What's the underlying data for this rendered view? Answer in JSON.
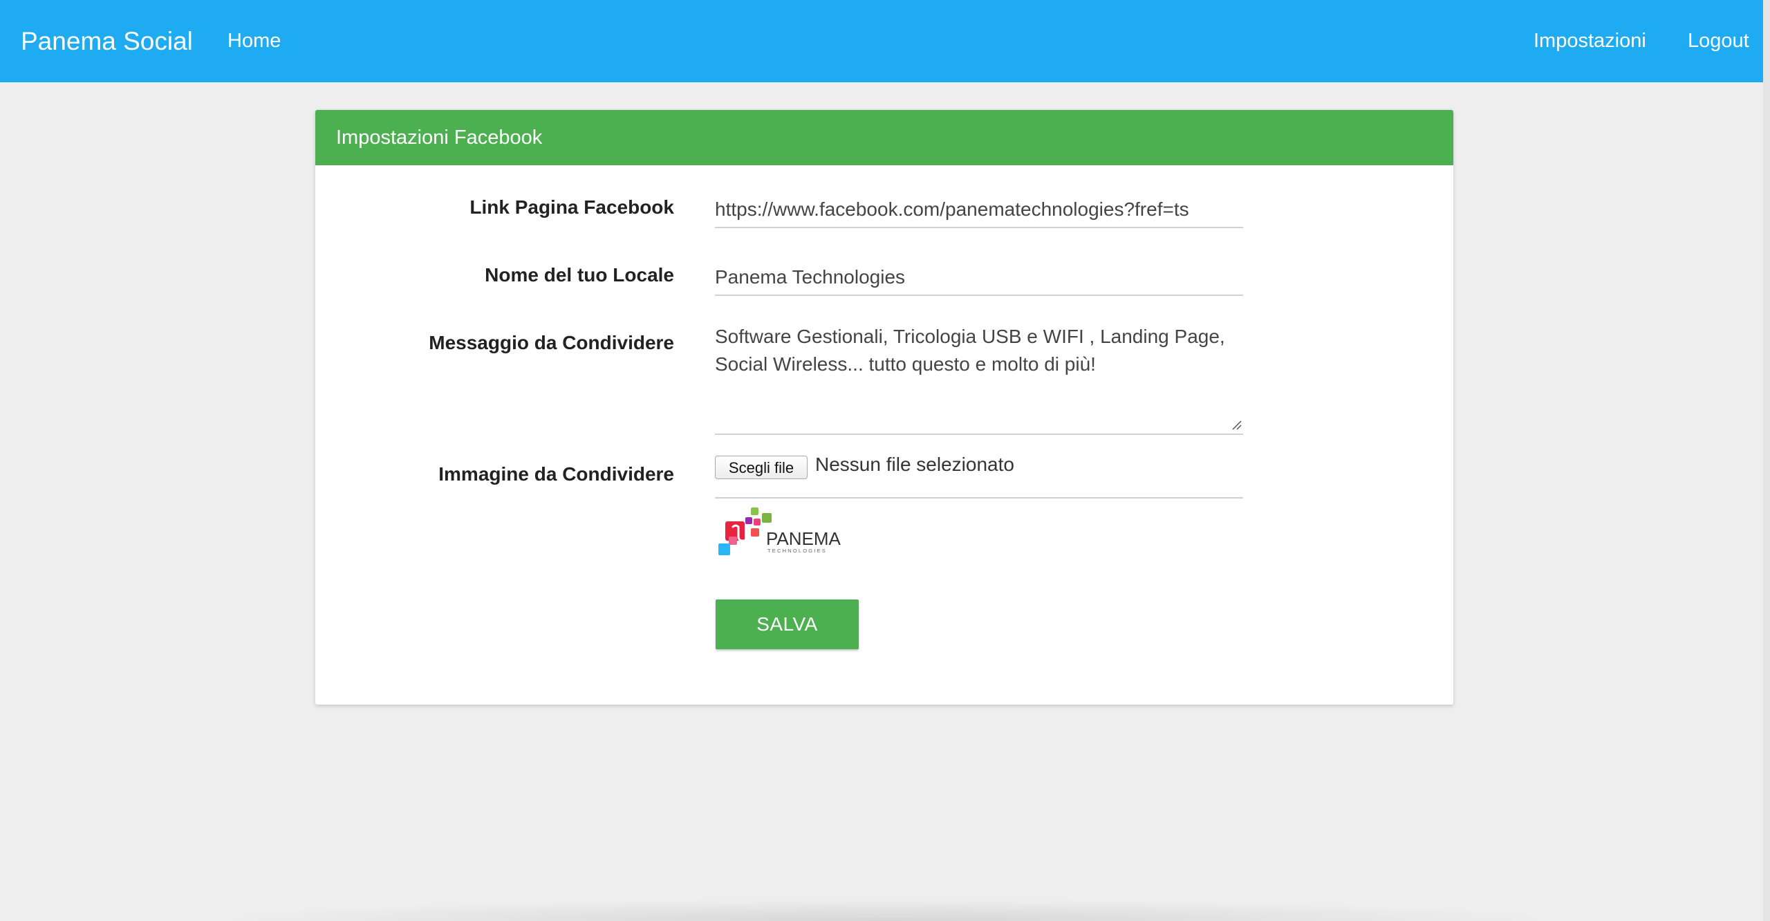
{
  "navbar": {
    "brand": "Panema Social",
    "home": "Home",
    "settings": "Impostazioni",
    "logout": "Logout",
    "color": "#1eabf1"
  },
  "panel": {
    "title": "Impostazioni Facebook",
    "header_color": "#4caf50"
  },
  "form": {
    "facebook_link": {
      "label": "Link Pagina Facebook",
      "value": "https://www.facebook.com/panematechnologies?fref=ts"
    },
    "venue_name": {
      "label": "Nome del tuo Locale",
      "value": "Panema Technologies"
    },
    "message": {
      "label": "Messaggio da Condividere",
      "value": "Software Gestionali, Tricologia USB e WIFI , Landing Page, Social Wireless... tutto questo e molto di più!"
    },
    "image": {
      "label": "Immagine da Condividere",
      "button": "Scegli file",
      "status": "Nessun file selezionato"
    },
    "preview_logo": {
      "brand": "PANEMA",
      "tagline": "TECHNOLOGIES"
    },
    "save_label": "SALVA"
  }
}
